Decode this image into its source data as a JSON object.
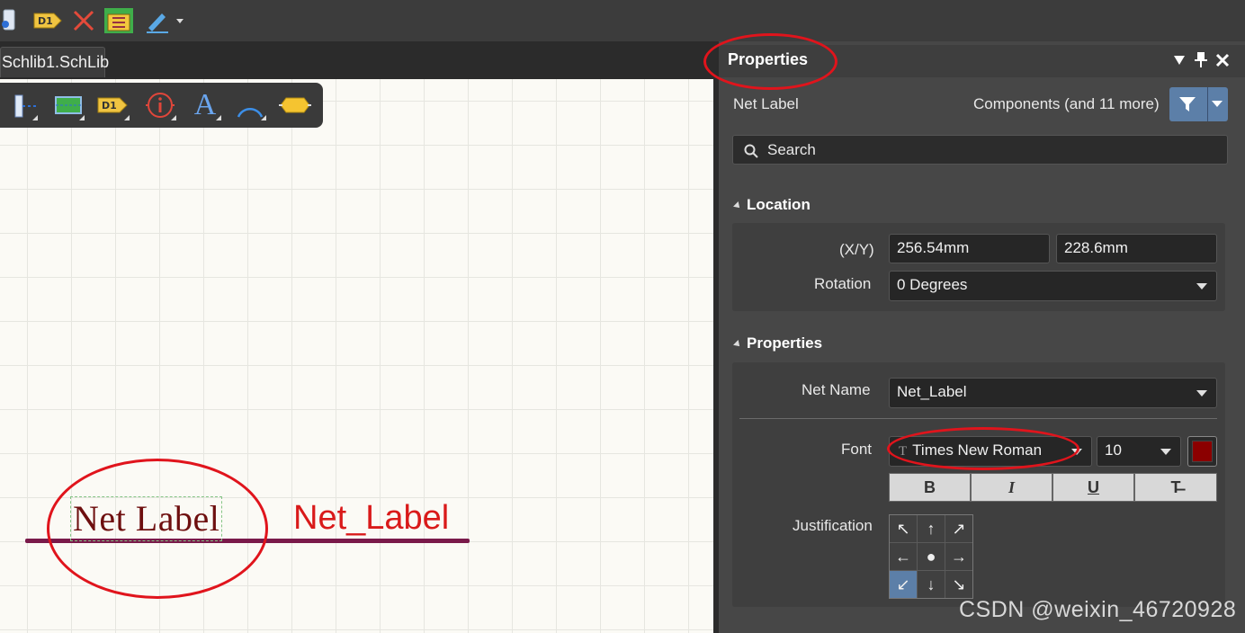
{
  "tab": {
    "label": "Schlib1.SchLib"
  },
  "toolbar": {
    "top_icons": [
      "pin-icon",
      "port-d1-icon",
      "delete-x-icon",
      "component-icon",
      "pen-icon"
    ],
    "top_badge": "D1",
    "place_icons": [
      "line-icon",
      "rectangle-icon",
      "port-icon",
      "info-icon",
      "text-icon",
      "arc-icon",
      "polygon-icon"
    ],
    "place_badge": "D1",
    "place_text_glyph": "A"
  },
  "canvas": {
    "label_serif": "Net  Label",
    "label_sans": "Net_Label"
  },
  "panel": {
    "title": "Properties",
    "object_type": "Net Label",
    "filter_label": "Components (and 11 more)",
    "search_placeholder": "Search",
    "location": {
      "title": "Location",
      "xy_label": "(X/Y)",
      "x_value": "256.54mm",
      "y_value": "228.6mm",
      "rotation_label": "Rotation",
      "rotation_value": "0 Degrees"
    },
    "properties": {
      "title": "Properties",
      "net_name_label": "Net Name",
      "net_name_value": "Net_Label",
      "font_label": "Font",
      "font_icon_glyph": "T",
      "font_value": "Times New Roman",
      "font_size": "10",
      "font_color": "#8b0000",
      "style_buttons": [
        "B",
        "I",
        "U",
        "T̶"
      ],
      "justification_label": "Justification",
      "justification_cells": [
        "↖",
        "↑",
        "↗",
        "←",
        "●",
        "→",
        "↙",
        "↓",
        "↘"
      ],
      "justification_selected": 6
    }
  },
  "watermark": "CSDN @weixin_46720928",
  "colors": {
    "accent": "#5c7fa8",
    "highlight_oval": "#e0141c",
    "wire": "#7a1a4a"
  }
}
